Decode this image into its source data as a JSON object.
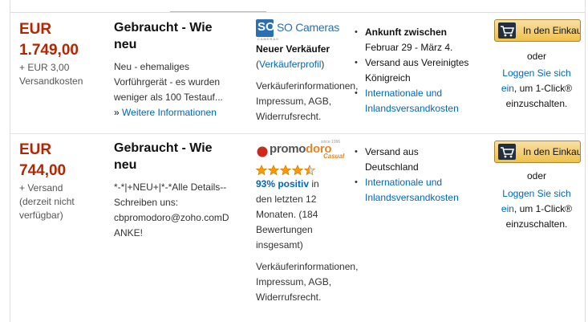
{
  "offers": [
    {
      "price_currency": "EUR",
      "price_amount": "1.749,00",
      "shipping_line1": "+ EUR 3,00",
      "shipping_line2": "Versandkosten",
      "condition_title_1": "Gebraucht - Wie",
      "condition_title_2": "neu",
      "condition_text": [
        "Neu - ehemaliges",
        "Vorführgerät - es wurden",
        "weniger als 100 Testauf..."
      ],
      "more_prefix": "»",
      "more_link": "Weitere Informationen",
      "seller_logo_text": "SO Cameras",
      "seller_logo_mark": "SO",
      "seller_logo_sub": "CAMERAS",
      "seller_status": "Neuer Verkäufer",
      "seller_profile_open": "(",
      "seller_profile_link": "Verkäuferprofil",
      "seller_profile_close": ")",
      "seller_info_links": [
        "Verkäuferinformationen,",
        "Impressum, AGB,",
        "Widerrufsrecht."
      ],
      "ship_arrival_title": "Ankunft zwischen",
      "ship_arrival_dates": "Februar 29 - März 4.",
      "ship_from": [
        "Versand aus Vereinigtes",
        "Königreich"
      ],
      "ship_link": [
        "Internationale und",
        "Inlandsversandkosten"
      ],
      "cart_label": "In den Einkaufswagen",
      "or_label": "oder",
      "login_link_1": "Loggen Sie sich",
      "login_link_2": "ein",
      "login_rest_2": ", um 1-Click®",
      "login_line_3": "einzuschalten."
    },
    {
      "price_currency": "EUR",
      "price_amount": "744,00",
      "shipping_lines": [
        "+ Versand",
        "(derzeit nicht",
        "verfügbar)"
      ],
      "condition_title_1": "Gebraucht - Wie",
      "condition_title_2": "neu",
      "condition_text": [
        "*-*|+NEU+|*-*Alle Details--",
        "Schreiben uns:",
        "cbpromodoro@zoho.comD",
        "ANKE!"
      ],
      "seller_logo_text_a": "promo",
      "seller_logo_text_b": "doro",
      "seller_logo_since": "since 1996",
      "seller_logo_casual": "Casual",
      "seller_rating_stars": 4.5,
      "seller_positive": "93% positiv",
      "seller_rating_text": [
        "in",
        "den letzten 12",
        "Monaten. (184",
        "Bewertungen",
        "insgesamt)"
      ],
      "seller_info_links": [
        "Verkäuferinformationen,",
        "Impressum, AGB,",
        "Widerrufsrecht."
      ],
      "ship_from": [
        "Versand aus",
        "Deutschland"
      ],
      "ship_link": [
        "Internationale und",
        "Inlandsversandkosten"
      ],
      "cart_label": "In den Einkaufswagen",
      "or_label": "oder",
      "login_link_1": "Loggen Sie sich",
      "login_link_2": "ein",
      "login_rest_2": ", um 1-Click®",
      "login_line_3": "einzuschalten."
    }
  ],
  "colors": {
    "price": "#b12704",
    "link": "#0066c0",
    "button": "#f0c14b",
    "star": "#ff9900"
  }
}
